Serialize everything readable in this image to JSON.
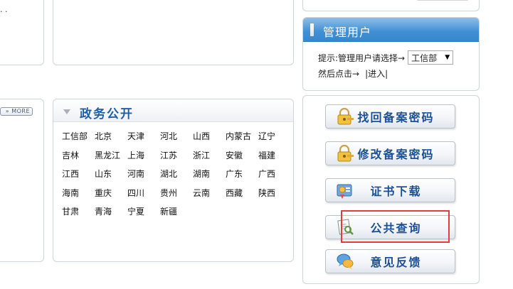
{
  "top_left": {
    "dots": ". ."
  },
  "manage_user": {
    "title": "管理用户",
    "hint": "提示:管理用户请选择→",
    "selected_department": "工信部",
    "then_click": "然后点击→",
    "enter_link": "|进入|"
  },
  "mid_left": {
    "more_label": "» MORE"
  },
  "gov_affairs": {
    "title": "政务公开",
    "regions": [
      "工信部",
      "北京",
      "天津",
      "河北",
      "山西",
      "内蒙古",
      "辽宁",
      "吉林",
      "黑龙江",
      "上海",
      "江苏",
      "浙江",
      "安徽",
      "福建",
      "江西",
      "山东",
      "河南",
      "湖北",
      "湖南",
      "广东",
      "广西",
      "海南",
      "重庆",
      "四川",
      "贵州",
      "云南",
      "西藏",
      "陕西",
      "甘肃",
      "青海",
      "宁夏",
      "新疆"
    ]
  },
  "buttons": {
    "retrieve": "找回备案密码",
    "modify": "修改备案密码",
    "download": "证书下载",
    "query": "公共查询",
    "feedback": "意见反馈"
  },
  "icons": {
    "retrieve": "lock-key-icon",
    "modify": "lock-key-icon",
    "download": "certificate-download-icon",
    "query": "document-search-icon",
    "feedback": "chat-bubbles-icon"
  },
  "colors": {
    "header_blue": "#3f8fd4",
    "title_blue": "#1f5fa8",
    "button_text": "#1a4f9a",
    "highlight_red": "#e43b3b"
  }
}
